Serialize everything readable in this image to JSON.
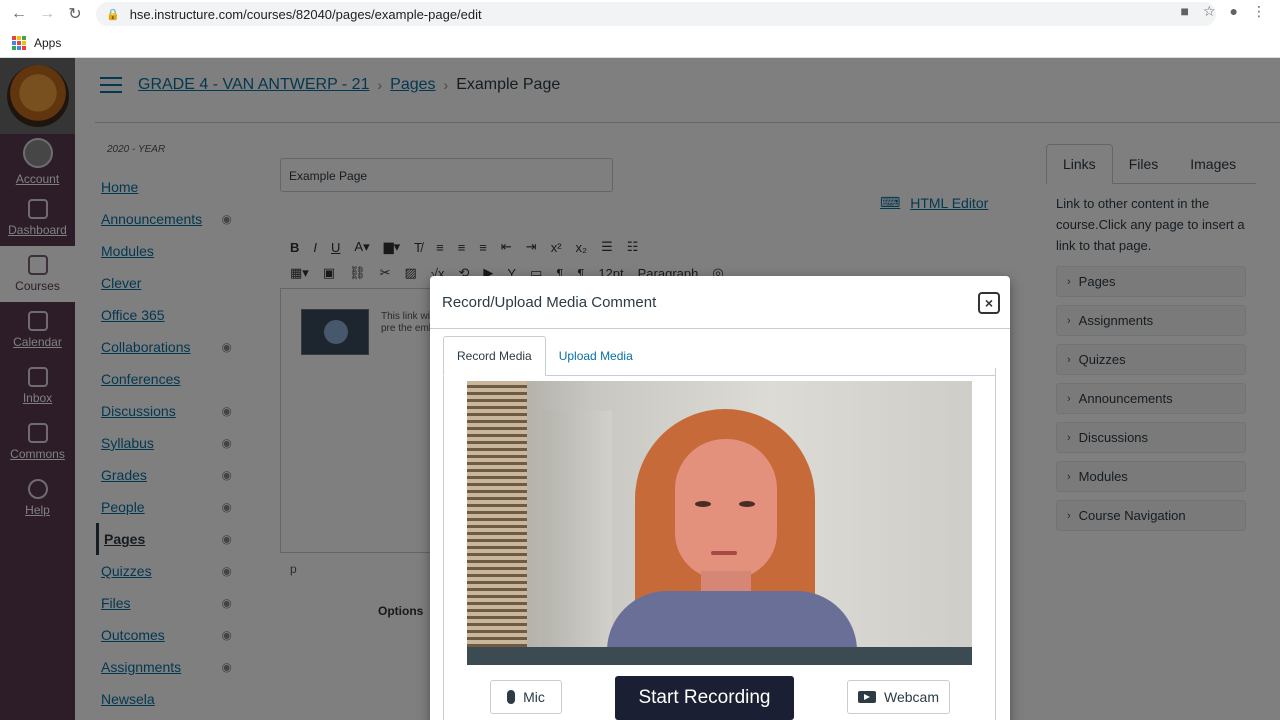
{
  "browser": {
    "url": "hse.instructure.com/courses/82040/pages/example-page/edit",
    "bookmarks_apps": "Apps"
  },
  "global_nav": {
    "items": [
      {
        "label": "Account"
      },
      {
        "label": "Dashboard"
      },
      {
        "label": "Courses"
      },
      {
        "label": "Calendar"
      },
      {
        "label": "Inbox"
      },
      {
        "label": "Commons"
      },
      {
        "label": "Help"
      }
    ]
  },
  "breadcrumb": {
    "course": "GRADE 4 - VAN ANTWERP - 21",
    "section": "Pages",
    "current": "Example Page"
  },
  "course_nav": {
    "term": "2020 - YEAR",
    "items": [
      {
        "label": "Home"
      },
      {
        "label": "Announcements"
      },
      {
        "label": "Modules"
      },
      {
        "label": "Clever"
      },
      {
        "label": "Office 365"
      },
      {
        "label": "Collaborations"
      },
      {
        "label": "Conferences"
      },
      {
        "label": "Discussions"
      },
      {
        "label": "Syllabus"
      },
      {
        "label": "Grades"
      },
      {
        "label": "People"
      },
      {
        "label": "Pages"
      },
      {
        "label": "Quizzes"
      },
      {
        "label": "Files"
      },
      {
        "label": "Outcomes"
      },
      {
        "label": "Assignments"
      },
      {
        "label": "Newsela"
      }
    ]
  },
  "editor": {
    "title_value": "Example Page",
    "html_editor_label": "HTML Editor",
    "font_size": "12pt",
    "block_format": "Paragraph",
    "snippet_text": "This link with a pre the embe",
    "path_label": "p",
    "options_label": "Options"
  },
  "right_panel": {
    "tabs": [
      "Links",
      "Files",
      "Images"
    ],
    "description": "Link to other content in the course.Click any page to insert a link to that page.",
    "items": [
      "Pages",
      "Assignments",
      "Quizzes",
      "Announcements",
      "Discussions",
      "Modules",
      "Course Navigation"
    ]
  },
  "modal": {
    "title": "Record/Upload Media Comment",
    "close_label": "×",
    "tabs": [
      "Record Media",
      "Upload Media"
    ],
    "mic_label": "Mic",
    "record_label": "Start Recording",
    "webcam_label": "Webcam"
  }
}
